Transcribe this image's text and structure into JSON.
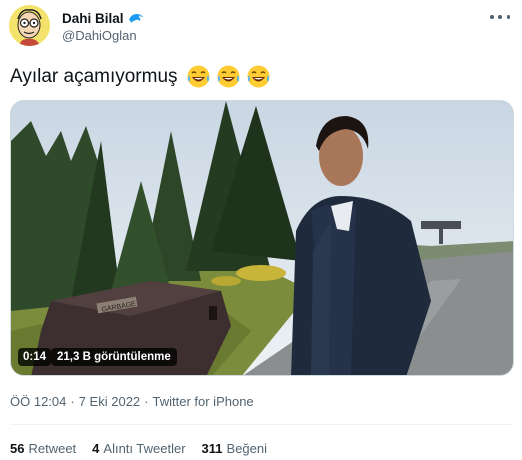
{
  "author": {
    "display_name": "Dahi Bilal",
    "handle": "@DahiOglan",
    "badge_icon": "dolphin-icon",
    "avatar_icon": "cartoon-avatar"
  },
  "tweet": {
    "text": "Ayılar açamıyormuş",
    "emojis": [
      "tears-of-joy-emoji",
      "tears-of-joy-emoji",
      "tears-of-joy-emoji"
    ]
  },
  "media": {
    "type": "video",
    "duration": "0:14",
    "views": "21,3 B görüntülenme",
    "bin_label": "GARBAGE"
  },
  "meta": {
    "time": "ÖÖ 12:04",
    "date": "7 Eki 2022",
    "separator": "·",
    "source": "Twitter for iPhone"
  },
  "stats": {
    "retweets_count": "56",
    "retweets_label": "Retweet",
    "quotes_count": "4",
    "quotes_label": "Alıntı Tweetler",
    "likes_count": "311",
    "likes_label": "Beğeni"
  },
  "colors": {
    "text_primary": "#0f1419",
    "text_secondary": "#536471",
    "divider": "#eff3f4",
    "badge_blue": "#1d9bf0"
  }
}
